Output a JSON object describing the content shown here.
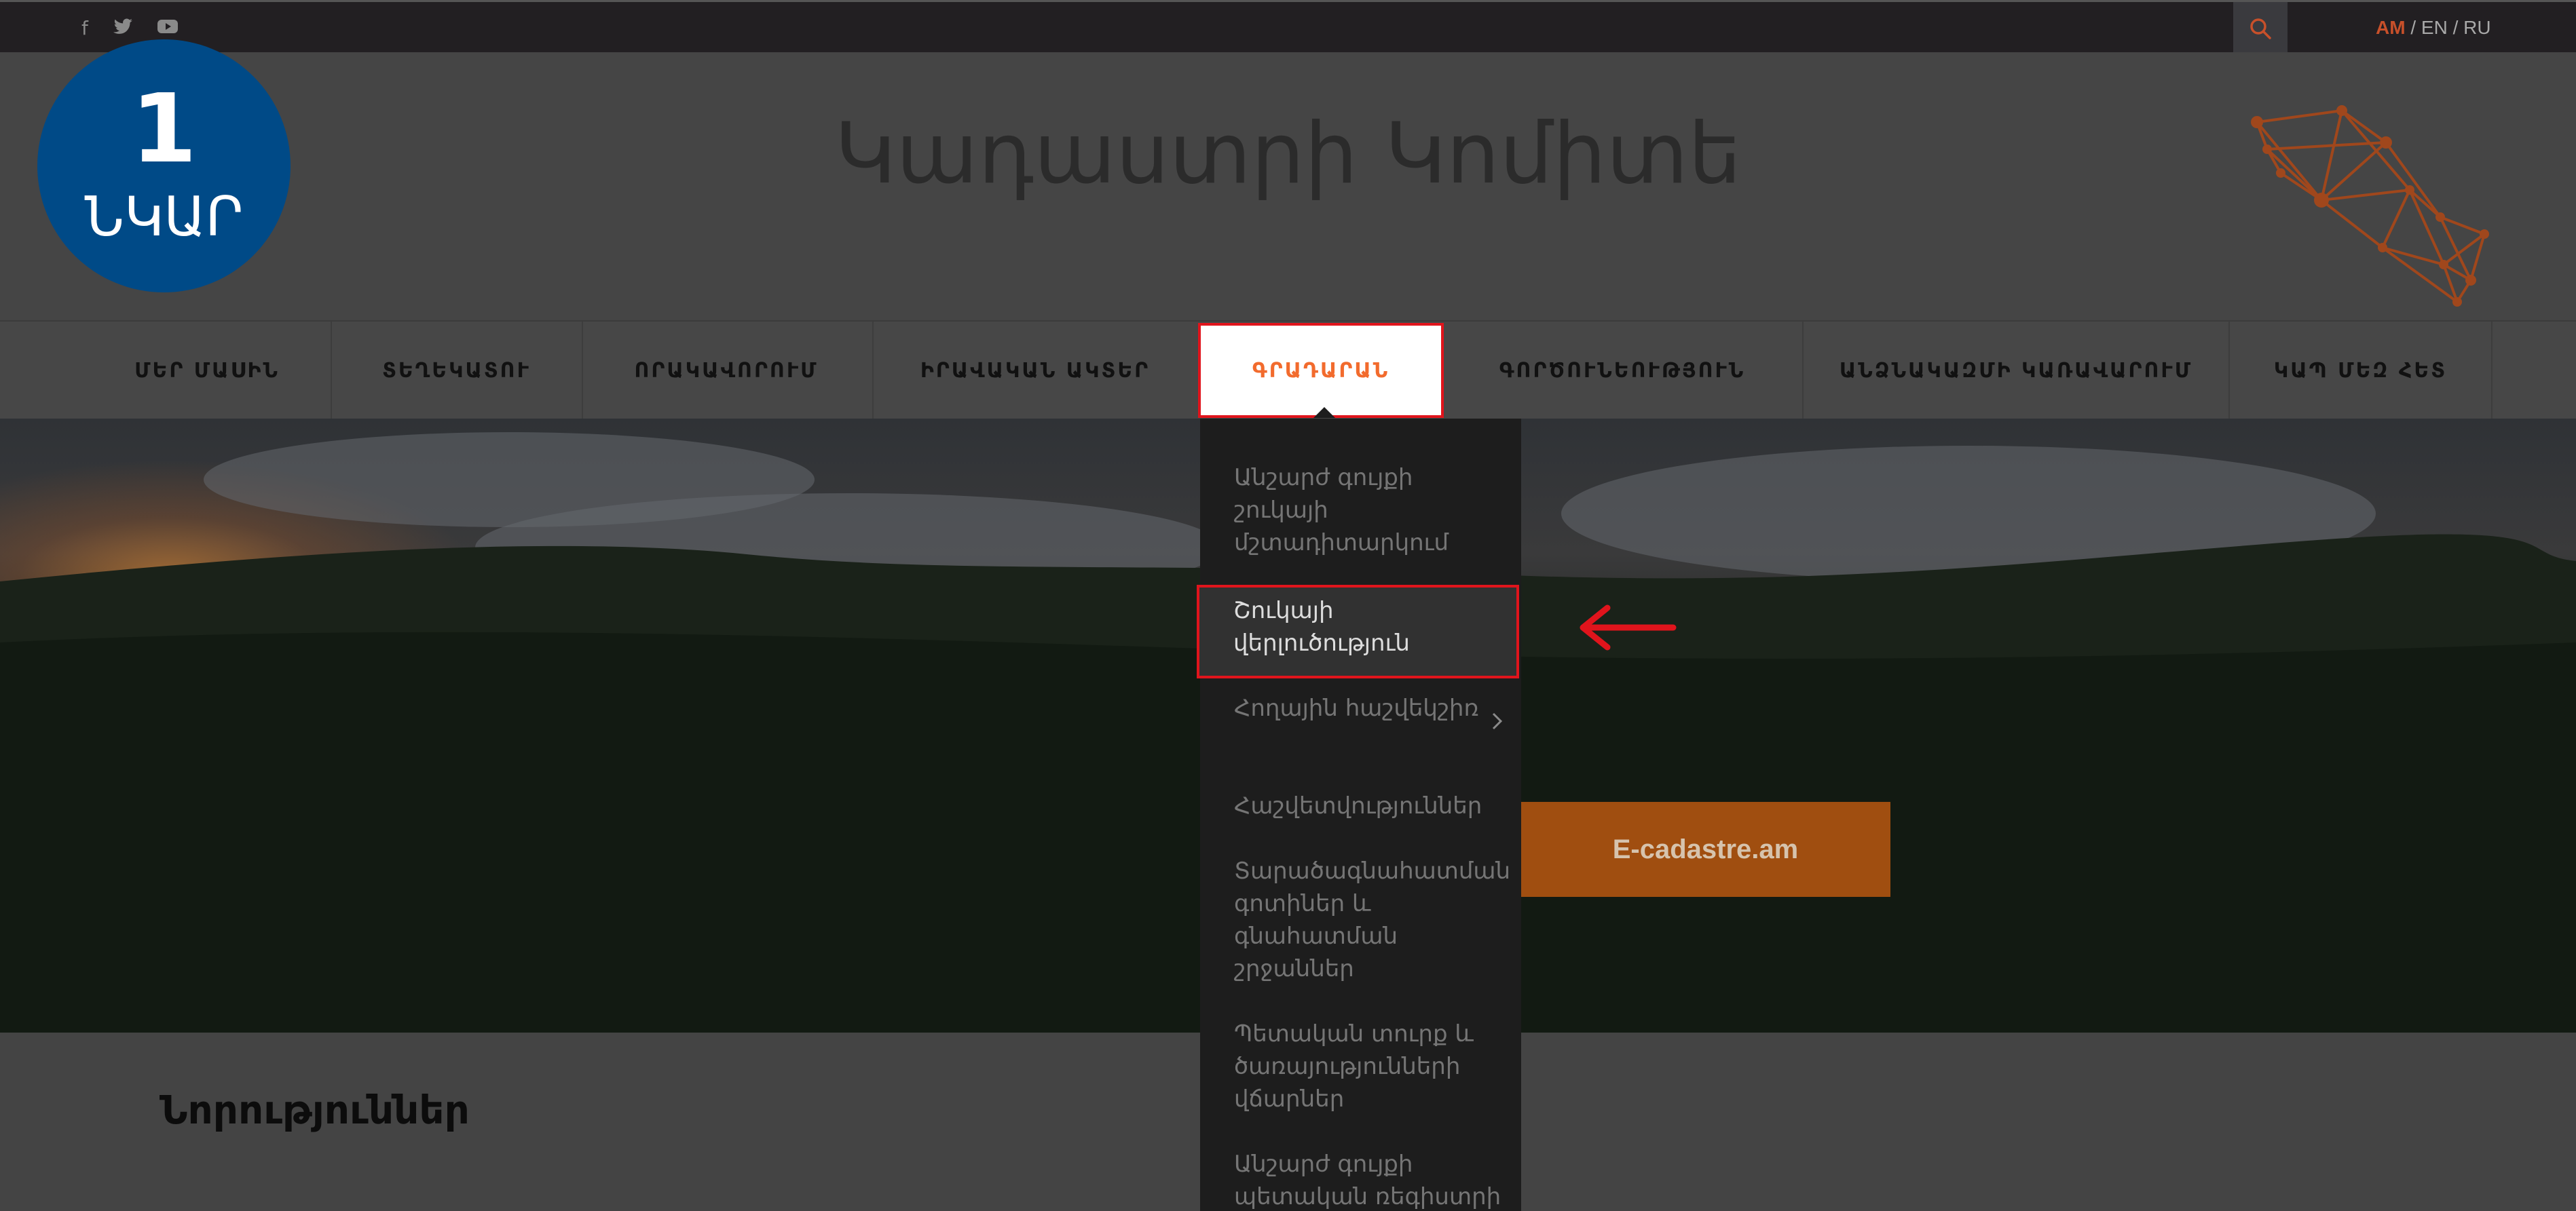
{
  "topbar": {
    "social": [
      {
        "icon": "facebook-icon",
        "glyph": "f"
      },
      {
        "icon": "twitter-icon",
        "glyph": "🐦"
      },
      {
        "icon": "youtube-icon",
        "glyph": "▶"
      }
    ],
    "search_icon": "search-icon",
    "lang_am": "AM",
    "lang_sep1": " / ",
    "lang_en": "EN",
    "lang_sep2": " / ",
    "lang_ru": "RU"
  },
  "badge": {
    "number": "1",
    "word": "ՆԿԱՐ"
  },
  "header": {
    "title": "Կադաստրի Կոմիտե"
  },
  "nav": {
    "items": [
      {
        "label": "ՄԵՐ ՄԱՍԻՆ"
      },
      {
        "label": "ՏԵՂԵԿԱՏՈՒ"
      },
      {
        "label": "ՈՐԱԿԱՎՈՐՈՒՄ"
      },
      {
        "label": "ԻՐԱՎԱԿԱՆ ԱԿՏԵՐ"
      },
      {
        "label": "ԳՐԱԴԱՐԱՆ"
      },
      {
        "label": "ԳՈՐԾՈՒՆԵՈՒԹՅՈՒՆ"
      },
      {
        "label": "ԱՆՁՆԱԿԱԶՄԻ ԿԱՌԱՎԱՐՈՒՄ"
      },
      {
        "label": "ԿԱՊ ՄԵԶ ՀԵՏ"
      }
    ],
    "active_index": 4
  },
  "dropdown": {
    "items": [
      {
        "label": "Անշարժ գույքի շուկայի մշտադիտարկում"
      },
      {
        "label": "Շուկայի վերլուծություն"
      },
      {
        "label": "Հողային հաշվեկշիռ"
      },
      {
        "label": "Հաշվետվություններ"
      },
      {
        "label": "Տարածագնահատման գոտիներ և գնահատման շրջաններ"
      },
      {
        "label": "Պետական տուրք և ծառայությունների վճարներ"
      },
      {
        "label": "Անշարժ գույքի պետական ռեգիստրի"
      }
    ],
    "highlighted_index": 1
  },
  "hero": {
    "cta_label": "E-cadastre.am"
  },
  "news": {
    "title": "Նորություններ"
  },
  "colors": {
    "accent": "#f26b2d",
    "highlight_border": "#e0141c",
    "badge_bg": "#004a87",
    "cta_bg": "#a04e10"
  }
}
